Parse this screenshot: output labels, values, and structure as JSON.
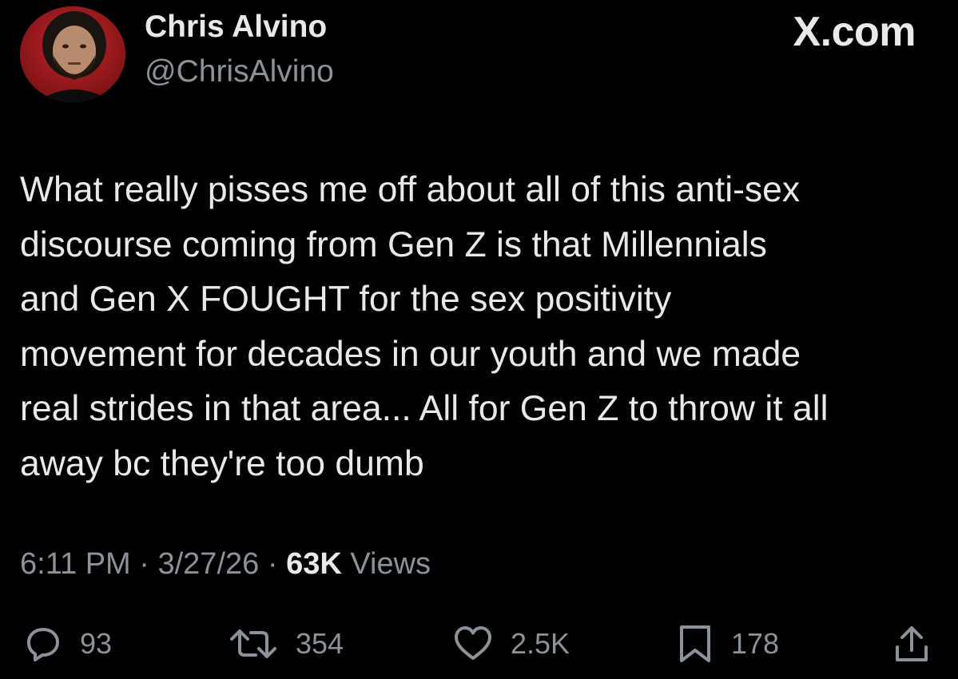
{
  "author": {
    "display_name": "Chris Alvino",
    "handle": "@ChrisAlvino",
    "avatar_icon": "profile-photo"
  },
  "brand": "X.com",
  "tweet": {
    "text": "What really pisses me off about all of this anti-sex\ndiscourse coming from Gen Z is that Millennials\nand Gen X FOUGHT for the sex positivity\nmovement for decades in our youth and we made\nreal strides in that area... All for Gen Z to throw it all\naway bc they're too dumb",
    "time": "6:11 PM",
    "date": "3/27/26",
    "separator": " · ",
    "views_count": "63K",
    "views_label": " Views"
  },
  "actions": {
    "replies": "93",
    "retweets": "354",
    "likes": "2.5K",
    "bookmarks": "178"
  },
  "colors": {
    "background": "#000000",
    "text": "#e7e9ea",
    "secondary": "#8b9299"
  }
}
